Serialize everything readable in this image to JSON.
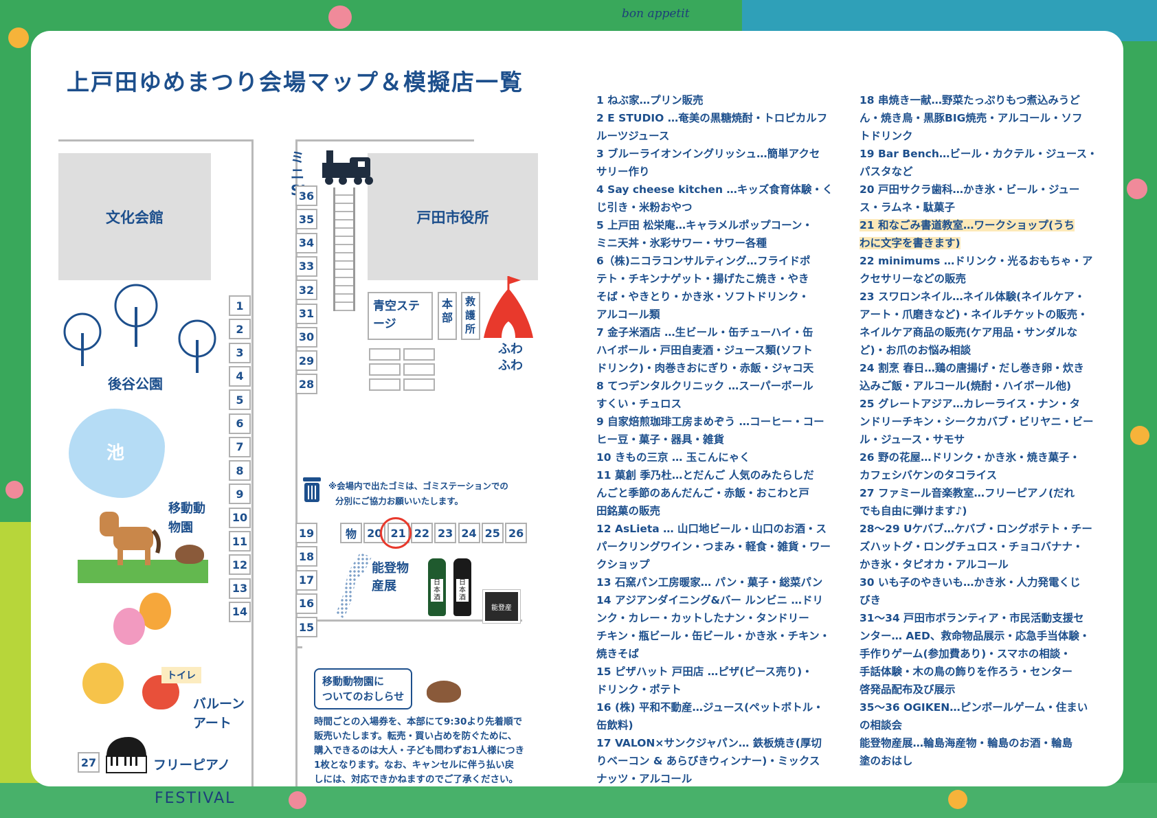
{
  "title": "上戸田ゆめまつり会場マップ＆模擬店一覧",
  "deco": {
    "bon_appetit": "bon appetit",
    "festival": "FESTIVAL"
  },
  "map": {
    "bunka_kaikan": "文化会館",
    "shiyakusho": "戸田市役所",
    "mini_sl": "ミニSL",
    "aozora_stage": "青空ステージ",
    "honbu": "本部",
    "kyugosho": "救護所",
    "fuwafuwa": "ふわふわ",
    "park": "後谷公園",
    "pond": "池",
    "zoo": "移動動物園",
    "balloon": "バルーンアート",
    "toilet": "トイレ",
    "piano": "フリーピアノ",
    "noto": "能登物産展",
    "garbage_note_1": "※会場内で出たゴミは、ゴミステーションでの",
    "garbage_note_2": "分別にご協力お願いいたします。",
    "left_stalls": [
      "1",
      "2",
      "3",
      "4",
      "5",
      "6",
      "7",
      "8",
      "9",
      "10",
      "11",
      "12",
      "13",
      "14"
    ],
    "mid_stalls_top": [
      "36",
      "35",
      "34",
      "33",
      "32",
      "31",
      "30",
      "29",
      "28"
    ],
    "mid_stalls_bottom": [
      "19",
      "18",
      "17",
      "16",
      "15"
    ],
    "row_stalls": [
      "物",
      "20",
      "21",
      "22",
      "23",
      "24",
      "25",
      "26"
    ],
    "stall_27": "27",
    "sake_label_1": "日本酒",
    "sake_label_2": "日本酒",
    "noto_box": "能登産",
    "highlight_stall": "21",
    "accent_color": "#e8392c",
    "primary_color": "#1d4f8c"
  },
  "notice": {
    "title_1": "移動動物園に",
    "title_2": "ついてのおしらせ",
    "lines": [
      "時間ごとの入場券を、本部にて9:30より先着順で",
      "販売いたします。転売・買い占めを防ぐために、",
      "購入できるのは大人・子ども問わずお1人様につき",
      "1枚となります。なお、キャンセルに伴う払い戻",
      "しには、対応できかねますのでご了承ください。"
    ]
  },
  "list_left": [
    "1 ねぶ家…プリン販売",
    "2 E STUDIO …奄美の黒糖焼酎・トロピカルフ",
    "ルーツジュース",
    "3 ブルーライオンイングリッシュ…簡単アクセ",
    "サリー作り",
    "4 Say cheese kitchen …キッズ食育体験・く",
    "じ引き・米粉おやつ",
    "5 上戸田 松栄庵…キャラメルポップコーン・",
    "ミニ天丼・氷彩サワー・サワー各種",
    "6（株)ニコラコンサルティング…フライドポ",
    "テト・チキンナゲット・揚げたこ焼き・やき",
    "そば・やきとり・かき氷・ソフトドリンク・",
    "アルコール類",
    "7 金子米酒店 …生ビール・缶チューハイ・缶",
    "ハイボール・戸田自麦酒・ジュース類(ソフト",
    "ドリンク)・肉巻きおにぎり・赤飯・ジャコ天",
    "8 てつデンタルクリニック …スーパーボール",
    "すくい・チュロス",
    "9 自家焙煎珈琲工房まめぞう …コーヒー・コー",
    "ヒー豆・菓子・器具・雑貨",
    "10 きもの三京 … 玉こんにゃく",
    "11 菓創 季乃杜…とだんご 人気のみたらしだ",
    "んごと季節のあんだんご・赤飯・おこわと戸",
    "田銘菓の販売",
    "12 AsLieta … 山口地ビール・山口のお酒・ス",
    "パークリングワイン・つまみ・軽食・雑貨・ワー",
    "クショップ",
    "13 石窯パン工房暖家… パン・菓子・総菜パン",
    "14 アジアンダイニング&バー ルンビニ …ドリ",
    "ンク・カレー・カットしたナン・タンドリー",
    "チキン・瓶ビール・缶ビール・かき氷・チキン・",
    "焼きそば",
    "15 ピザハット 戸田店 …ピザ(ピース売り)・",
    "ドリンク・ポテト",
    "16 (株) 平和不動産…ジュース(ペットボトル・",
    "缶飲料)",
    "17 VALON×サンクジャパン… 鉄板焼き(厚切",
    "りベーコン & あらびきウィンナー)・ミックス",
    "ナッツ・アルコール"
  ],
  "list_right": [
    "18 串焼き一献…野菜たっぷりもつ煮込みうど",
    "ん・焼き鳥・黒豚BIG焼売・アルコール・ソフ",
    "トドリンク",
    "19 Bar Bench…ビール・カクテル・ジュース・",
    "パスタなど",
    "20 戸田サクラ歯科…かき氷・ビール・ジュー",
    "ス・ラムネ・駄菓子",
    "21 和なごみ書道教室…ワークショップ(うち",
    "わに文字を書きます)",
    "22 minimums …ドリンク・光るおもちゃ・ア",
    "クセサリーなどの販売",
    "23 スワロンネイル…ネイル体験(ネイルケア・",
    "アート・爪磨きなど)・ネイルチケットの販売・",
    "ネイルケア商品の販売(ケア用品・サンダルな",
    "ど)・お爪のお悩み相談",
    "24 割烹 春日…鶏の唐揚げ・だし巻き卵・炊き",
    "込みご飯・アルコール(焼酎・ハイボール他)",
    "25 グレートアジア…カレーライス・ナン・タ",
    "ンドリーチキン・シークカバブ・ビリヤニ・ビー",
    "ル・ジュース・サモサ",
    "26 野の花屋…ドリンク・かき氷・焼き菓子・",
    "カフェシバケンのタコライス",
    "27 ファミール音楽教室…フリーピアノ(だれ",
    "でも自由に弾けます♪)",
    "28〜29 Uケバブ…ケバブ・ロングポテト・チー",
    "ズハットグ・ロングチュロス・チョコバナナ・",
    "かき氷・タピオカ・アルコール",
    "30 いも子のやきいも…かき氷・人力発電くじ",
    "びき",
    "31〜34 戸田市ボランティア・市民活動支援セ",
    "ンター… AED、救命物品展示・応急手当体験・",
    "手作りゲーム(参加費あり)・スマホの相談・",
    "手話体験・木の鳥の飾りを作ろう・センター",
    "啓発品配布及び展示",
    "35〜36 OGIKEN…ピンボールゲーム・住まい",
    "の相談会",
    "能登物産展…輪島海産物・輪島のお酒・輪島",
    "塗のおはし"
  ]
}
